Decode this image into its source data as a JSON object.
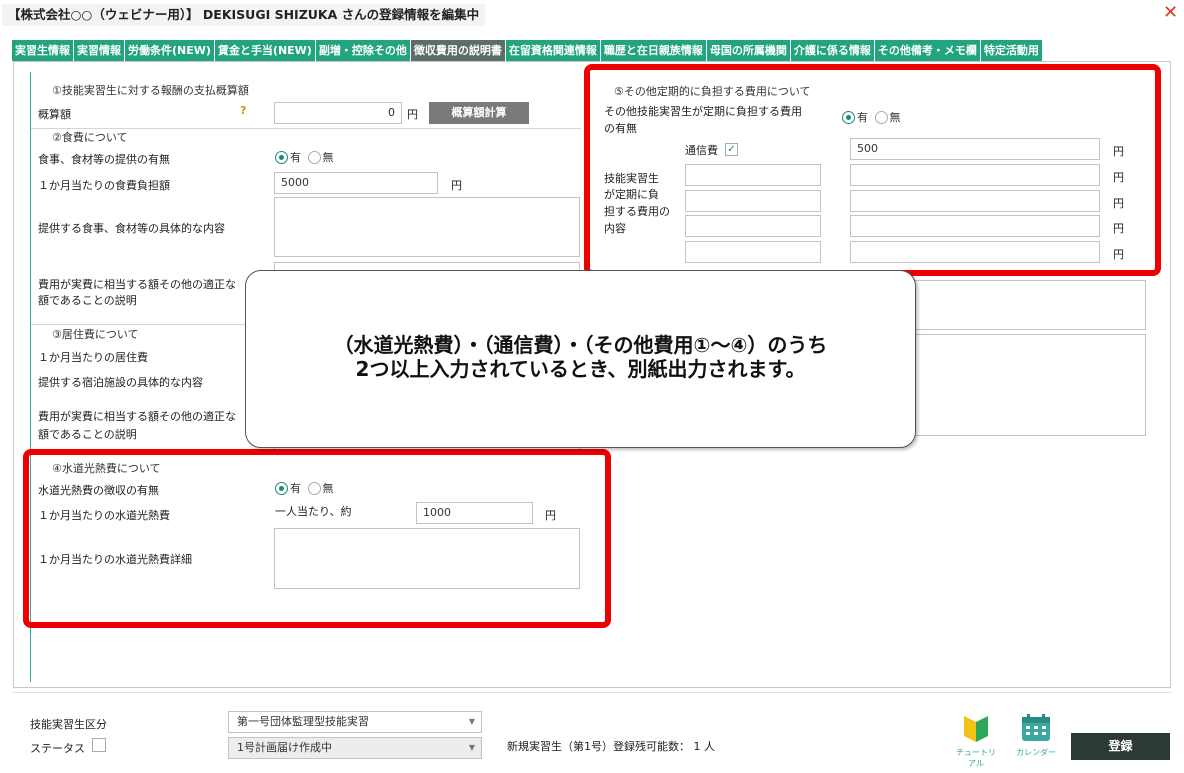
{
  "window": {
    "title": "【株式会社○○（ウェビナー用）】 DEKISUGI SHIZUKA さんの登録情報を編集中",
    "close": "✕"
  },
  "tabs": [
    {
      "label": "実習生情報"
    },
    {
      "label": "実習情報"
    },
    {
      "label": "労働条件(NEW)"
    },
    {
      "label": "賃金と手当(NEW)"
    },
    {
      "label": "副増・控除その他"
    },
    {
      "label": "徴収費用の説明書"
    },
    {
      "label": "在留資格関連情報"
    },
    {
      "label": "職歴と在日親族情報"
    },
    {
      "label": "母国の所属機関"
    },
    {
      "label": "介護に係る情報"
    },
    {
      "label": "その他備考・メモ欄"
    },
    {
      "label": "特定活動用"
    }
  ],
  "sec1": {
    "heading": "①技能実習生に対する報酬の支払概算額",
    "label": "概算額",
    "help": "?",
    "value": "0",
    "unit": "円",
    "calc_button": "概算額計算"
  },
  "sec2": {
    "heading": "②食費について",
    "provided_label": "食事、食材等の提供の有無",
    "yes": "有",
    "no": "無",
    "monthly_label": "１か月当たりの食費負担額",
    "monthly_value": "5000",
    "unit": "円",
    "content_label": "提供する食事、食材等の具体的な内容",
    "explain_label_1": "費用が実費に相当する額その他の適正な",
    "explain_label_2": "額であることの説明"
  },
  "sec3": {
    "heading": "③居住費について",
    "monthly_label": "１か月当たりの居住費",
    "facility_label": "提供する宿泊施設の具体的な内容",
    "explain_label_1": "費用が実費に相当する額その他の適正な",
    "explain_label_2": "額であることの説明"
  },
  "sec4": {
    "heading": "④水道光熱費について",
    "provided_label": "水道光熱費の徴収の有無",
    "yes": "有",
    "no": "無",
    "monthly_label": "１か月当たりの水道光熱費",
    "per_person": "一人当たり、約",
    "value": "1000",
    "unit": "円",
    "detail_label": "１か月当たりの水道光熱費詳細"
  },
  "sec5": {
    "heading": "⑤その他定期的に負担する費用について",
    "question_1": "その他技能実習生が定期に負担する費用",
    "question_2": "の有無",
    "yes": "有",
    "no": "無",
    "comm_label": "通信費",
    "comm_checked": "✓",
    "comm_value": "500",
    "unit": "円",
    "content_label_1": "技能実習生",
    "content_label_2": "が定期に負",
    "content_label_3": "担する費用の",
    "content_label_4": "内容"
  },
  "callout": {
    "line1": "（水道光熱費）・（通信費）・（その他費用①～④）のうち",
    "line2": "2つ以上入力されているとき、別紙出力されます。"
  },
  "footer": {
    "category_label": "技能実習生区分",
    "category_value": "第一号団体監理型技能実習",
    "status_label": "ステータス",
    "status_value": "1号計画届け作成中",
    "remaining": "新規実習生（第1号）登録残可能数： 1 人",
    "tutorial": "チュートリアル",
    "calendar": "カレンダー",
    "register": "登録"
  },
  "colors": {
    "tab": "#22a57e",
    "tab_active": "#5b6e6a",
    "highlight": "#ee0000",
    "register": "#2c3a35"
  }
}
